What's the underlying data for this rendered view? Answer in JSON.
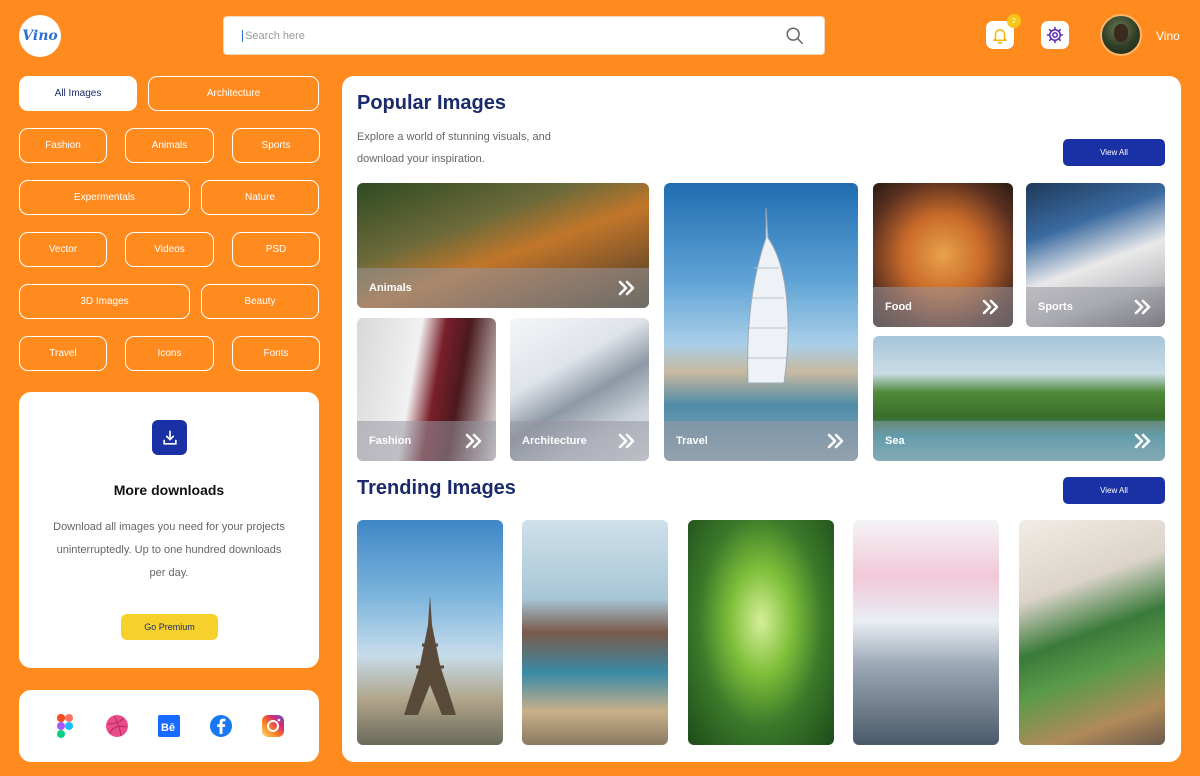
{
  "header": {
    "logo_text": "Vino",
    "search_placeholder": "Search here",
    "notification_count": "2",
    "username": "Vino"
  },
  "categories": [
    "All Images",
    "Architecture",
    "Fashion",
    "Animals",
    "Sports",
    "Expermentals",
    "Nature",
    "Vector",
    "Videos",
    "PSD",
    "3D Images",
    "Beauty",
    "Travel",
    "Icons",
    "Fonts"
  ],
  "promo": {
    "title": "More downloads",
    "text": "Download all images you need for your projects uninterruptedly. Up to one hundred downloads per day.",
    "button": "Go Premium"
  },
  "social": [
    "figma-icon",
    "dribbble-icon",
    "behance-icon",
    "facebook-icon",
    "instagram-icon"
  ],
  "popular": {
    "title": "Popular Images",
    "description": "Explore a world of stunning visuals, and download your inspiration.",
    "view_all": "View All",
    "tiles": [
      "Animals",
      "Fashion",
      "Architecture",
      "Travel",
      "Food",
      "Sports",
      "Sea"
    ]
  },
  "trending": {
    "title": "Trending Images",
    "view_all": "View All"
  },
  "colors": {
    "background": "#FF8A1E",
    "accent": "#1a31a6",
    "title": "#1a2a6c",
    "premium": "#F7D12B"
  }
}
